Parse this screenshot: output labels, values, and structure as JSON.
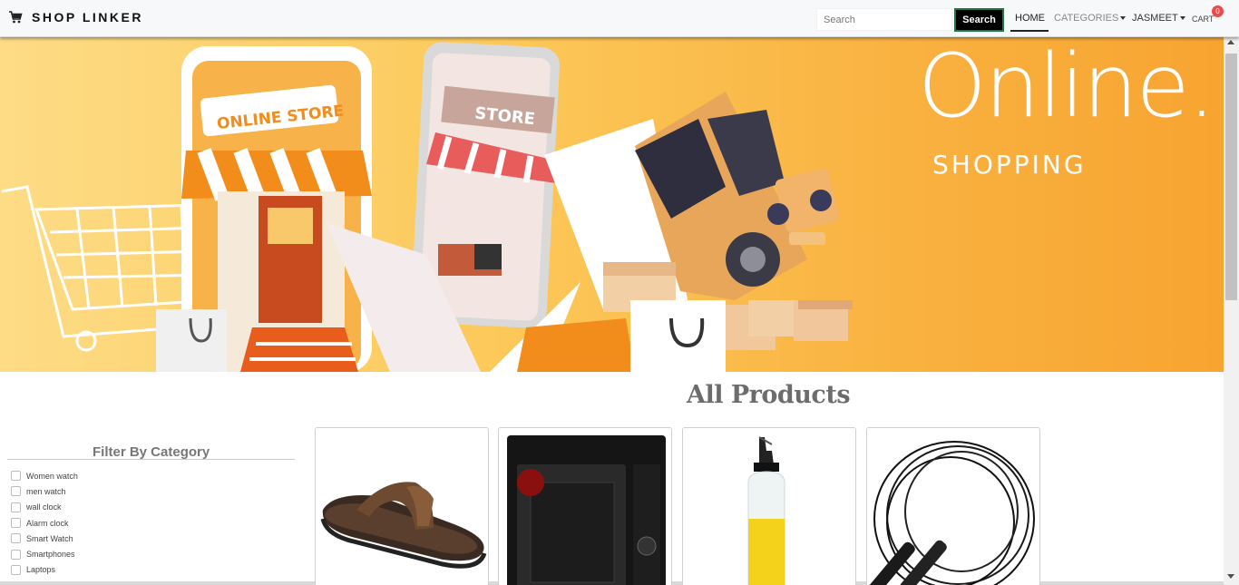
{
  "brand": {
    "name": "SHOP LINKER",
    "icon": "cart-icon"
  },
  "search": {
    "placeholder": "Search",
    "value": "",
    "button_label": "Search"
  },
  "nav": {
    "home": "HOME",
    "categories": "CATEGORIES",
    "user": "JASMEET",
    "cart": "CART",
    "cart_count": "0"
  },
  "hero": {
    "title": "Online.",
    "subtitle": "SHOPPING",
    "store_sign": "ONLINE STORE",
    "phone_sign": "STORE"
  },
  "products": {
    "heading": "All Products",
    "items": [
      {
        "icon": "sandal-icon"
      },
      {
        "icon": "microwave-icon"
      },
      {
        "icon": "oil-bottle-icon"
      },
      {
        "icon": "skipping-rope-icon"
      }
    ]
  },
  "filter": {
    "title": "Filter By Category",
    "categories": [
      "Women watch",
      "men watch",
      "wall clock",
      "Alarm clock",
      "Smart Watch",
      "Smartphones",
      "Laptops"
    ]
  },
  "colors": {
    "accent": "#f8a431",
    "navbar_bg": "#f7f8fa",
    "badge": "#e84c4c"
  }
}
